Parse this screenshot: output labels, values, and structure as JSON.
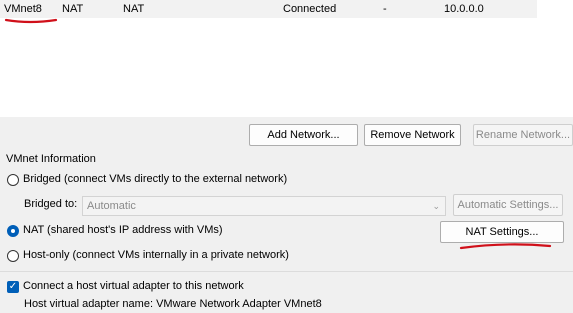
{
  "network_list": {
    "row": {
      "name": "VMnet8",
      "type": "NAT",
      "external": "NAT",
      "host_connection": "Connected",
      "dhcp": "-",
      "subnet": "10.0.0.0"
    }
  },
  "buttons": {
    "add": "Add Network...",
    "remove": "Remove Network",
    "rename": "Rename Network..."
  },
  "vmnet_info": {
    "title": "VMnet Information",
    "bridged_label": "Bridged (connect VMs directly to the external network)",
    "bridged_to_label": "Bridged to:",
    "bridged_to_value": "Automatic",
    "automatic_settings": "Automatic Settings...",
    "nat_label": "NAT (shared host's IP address with VMs)",
    "nat_settings": "NAT Settings...",
    "host_only_label": "Host-only (connect VMs internally in a private network)",
    "selected_mode": "nat"
  },
  "host_adapter": {
    "connect_label": "Connect a host virtual adapter to this network",
    "connect_checked": true,
    "adapter_name_text": "Host virtual adapter name: VMware Network Adapter VMnet8"
  },
  "annotation_color": "#d0101a",
  "accent_color": "#005fb8",
  "icons": {
    "checkbox_check": "check-icon",
    "dropdown": "chevron-down-icon"
  }
}
